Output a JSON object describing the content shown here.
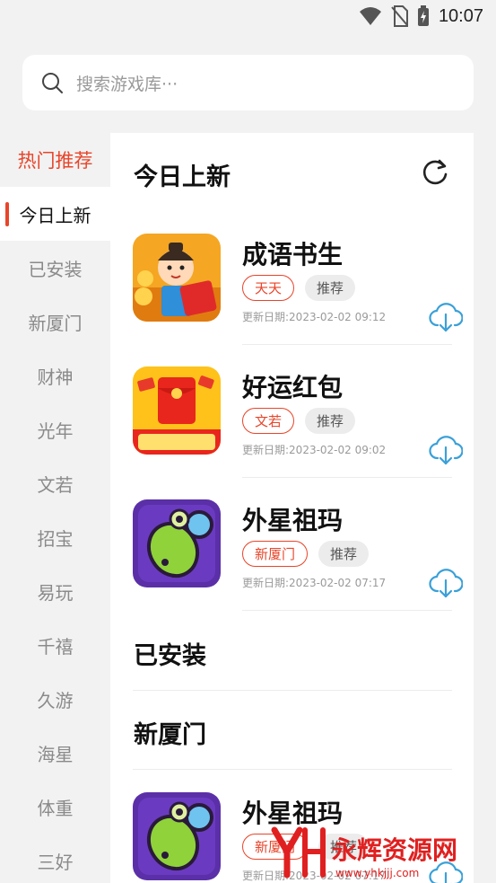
{
  "status": {
    "time": "10:07"
  },
  "search": {
    "placeholder": "搜索游戏库···"
  },
  "sidebar": {
    "items": [
      {
        "label": "热门推荐"
      },
      {
        "label": "今日上新"
      },
      {
        "label": "已安装"
      },
      {
        "label": "新厦门"
      },
      {
        "label": "财神"
      },
      {
        "label": "光年"
      },
      {
        "label": "文若"
      },
      {
        "label": "招宝"
      },
      {
        "label": "易玩"
      },
      {
        "label": "千禧"
      },
      {
        "label": "久游"
      },
      {
        "label": "海星"
      },
      {
        "label": "体重"
      },
      {
        "label": "三好"
      }
    ]
  },
  "main": {
    "sections": [
      {
        "title": "今日上新"
      },
      {
        "title": "已安装"
      },
      {
        "title": "新厦门"
      }
    ],
    "games": [
      {
        "name": "成语书生",
        "tag_source": "天天",
        "tag_rec": "推荐",
        "date": "更新日期:2023-02-02 09:12",
        "icon": "idiom-scholar-icon"
      },
      {
        "name": "好运红包",
        "tag_source": "文若",
        "tag_rec": "推荐",
        "date": "更新日期:2023-02-02 09:02",
        "icon": "red-envelope-icon"
      },
      {
        "name": "外星祖玛",
        "tag_source": "新厦门",
        "tag_rec": "推荐",
        "date": "更新日期:2023-02-02 07:17",
        "icon": "alien-zuma-icon"
      },
      {
        "name": "外星祖玛",
        "tag_source": "新厦门",
        "tag_rec": "推荐",
        "date": "更新日期:2023-02-02 07:17",
        "icon": "alien-zuma-icon"
      }
    ]
  },
  "watermark": {
    "brand": "永辉资源网",
    "url": "www.yhkjjj.com"
  },
  "colors": {
    "accent": "#e8452a",
    "download": "#3aa0d8",
    "background": "#f2f2f2"
  }
}
